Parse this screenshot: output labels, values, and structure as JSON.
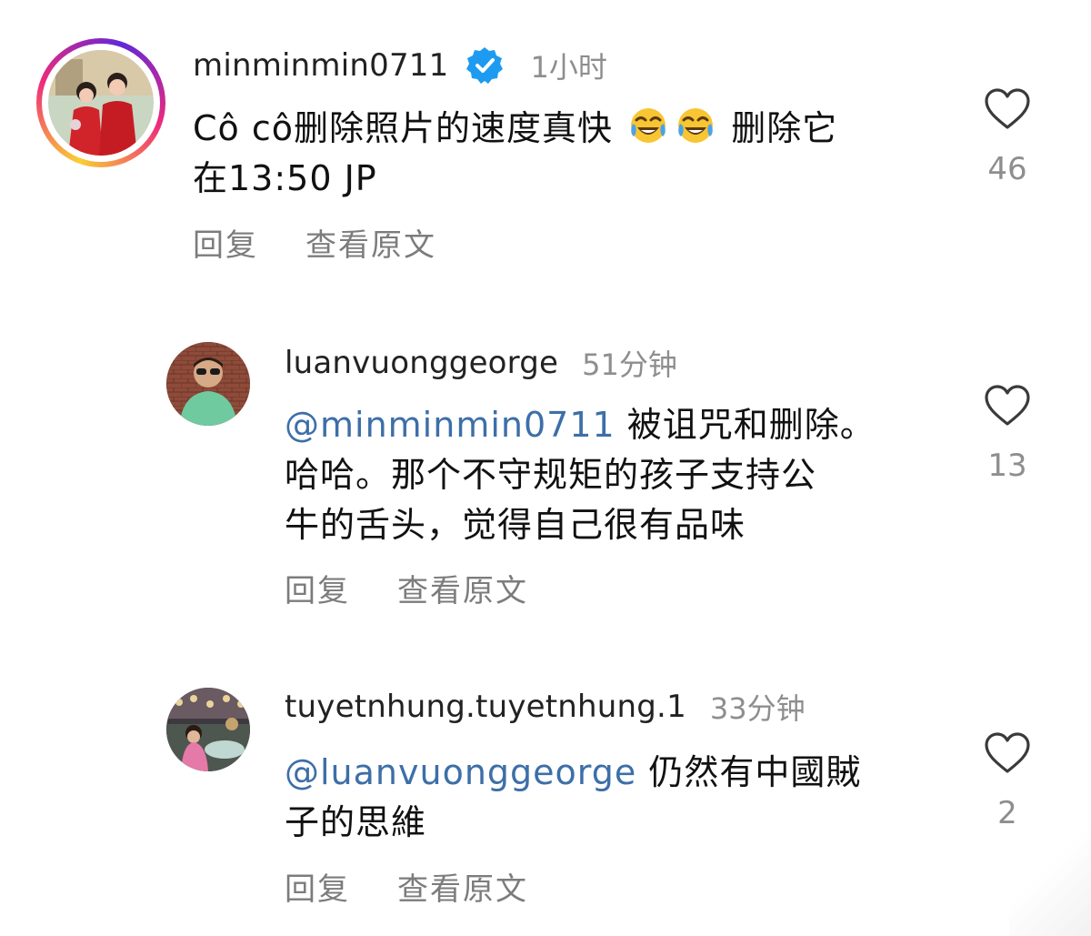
{
  "comments": [
    {
      "username": "minminmin0711",
      "verified": true,
      "time": "1小时",
      "text_line1_pre": "Cô cô删除照片的速度真快",
      "text_line1_post": "删除它",
      "text_line2": "在13:50 JP",
      "emoji": [
        "joy-emoji",
        "joy-emoji"
      ],
      "reply_label": "回复",
      "translate_label": "查看原文",
      "likes": "46",
      "like_icon": "heart-icon"
    },
    {
      "username": "luanvuonggeorge",
      "time": "51分钟",
      "mention": "@minminmin0711",
      "text_line1_after": " 被诅咒和删除。",
      "text_line2": "哈哈。那个不守规矩的孩子支持公",
      "text_line3": "牛的舌头，觉得自己很有品味",
      "reply_label": "回复",
      "translate_label": "查看原文",
      "likes": "13",
      "like_icon": "heart-icon"
    },
    {
      "username": "tuyetnhung.tuyetnhung.1",
      "time": "33分钟",
      "mention": "@luanvuonggeorge",
      "text_line1_after": " 仍然有中國賊",
      "text_line2": "子的思維",
      "reply_label": "回复",
      "translate_label": "查看原文",
      "likes": "2",
      "like_icon": "heart-icon"
    }
  ],
  "colors": {
    "mention": "#3d6fa8",
    "verified": "#1d9bf0",
    "muted": "#8e8e8e"
  }
}
